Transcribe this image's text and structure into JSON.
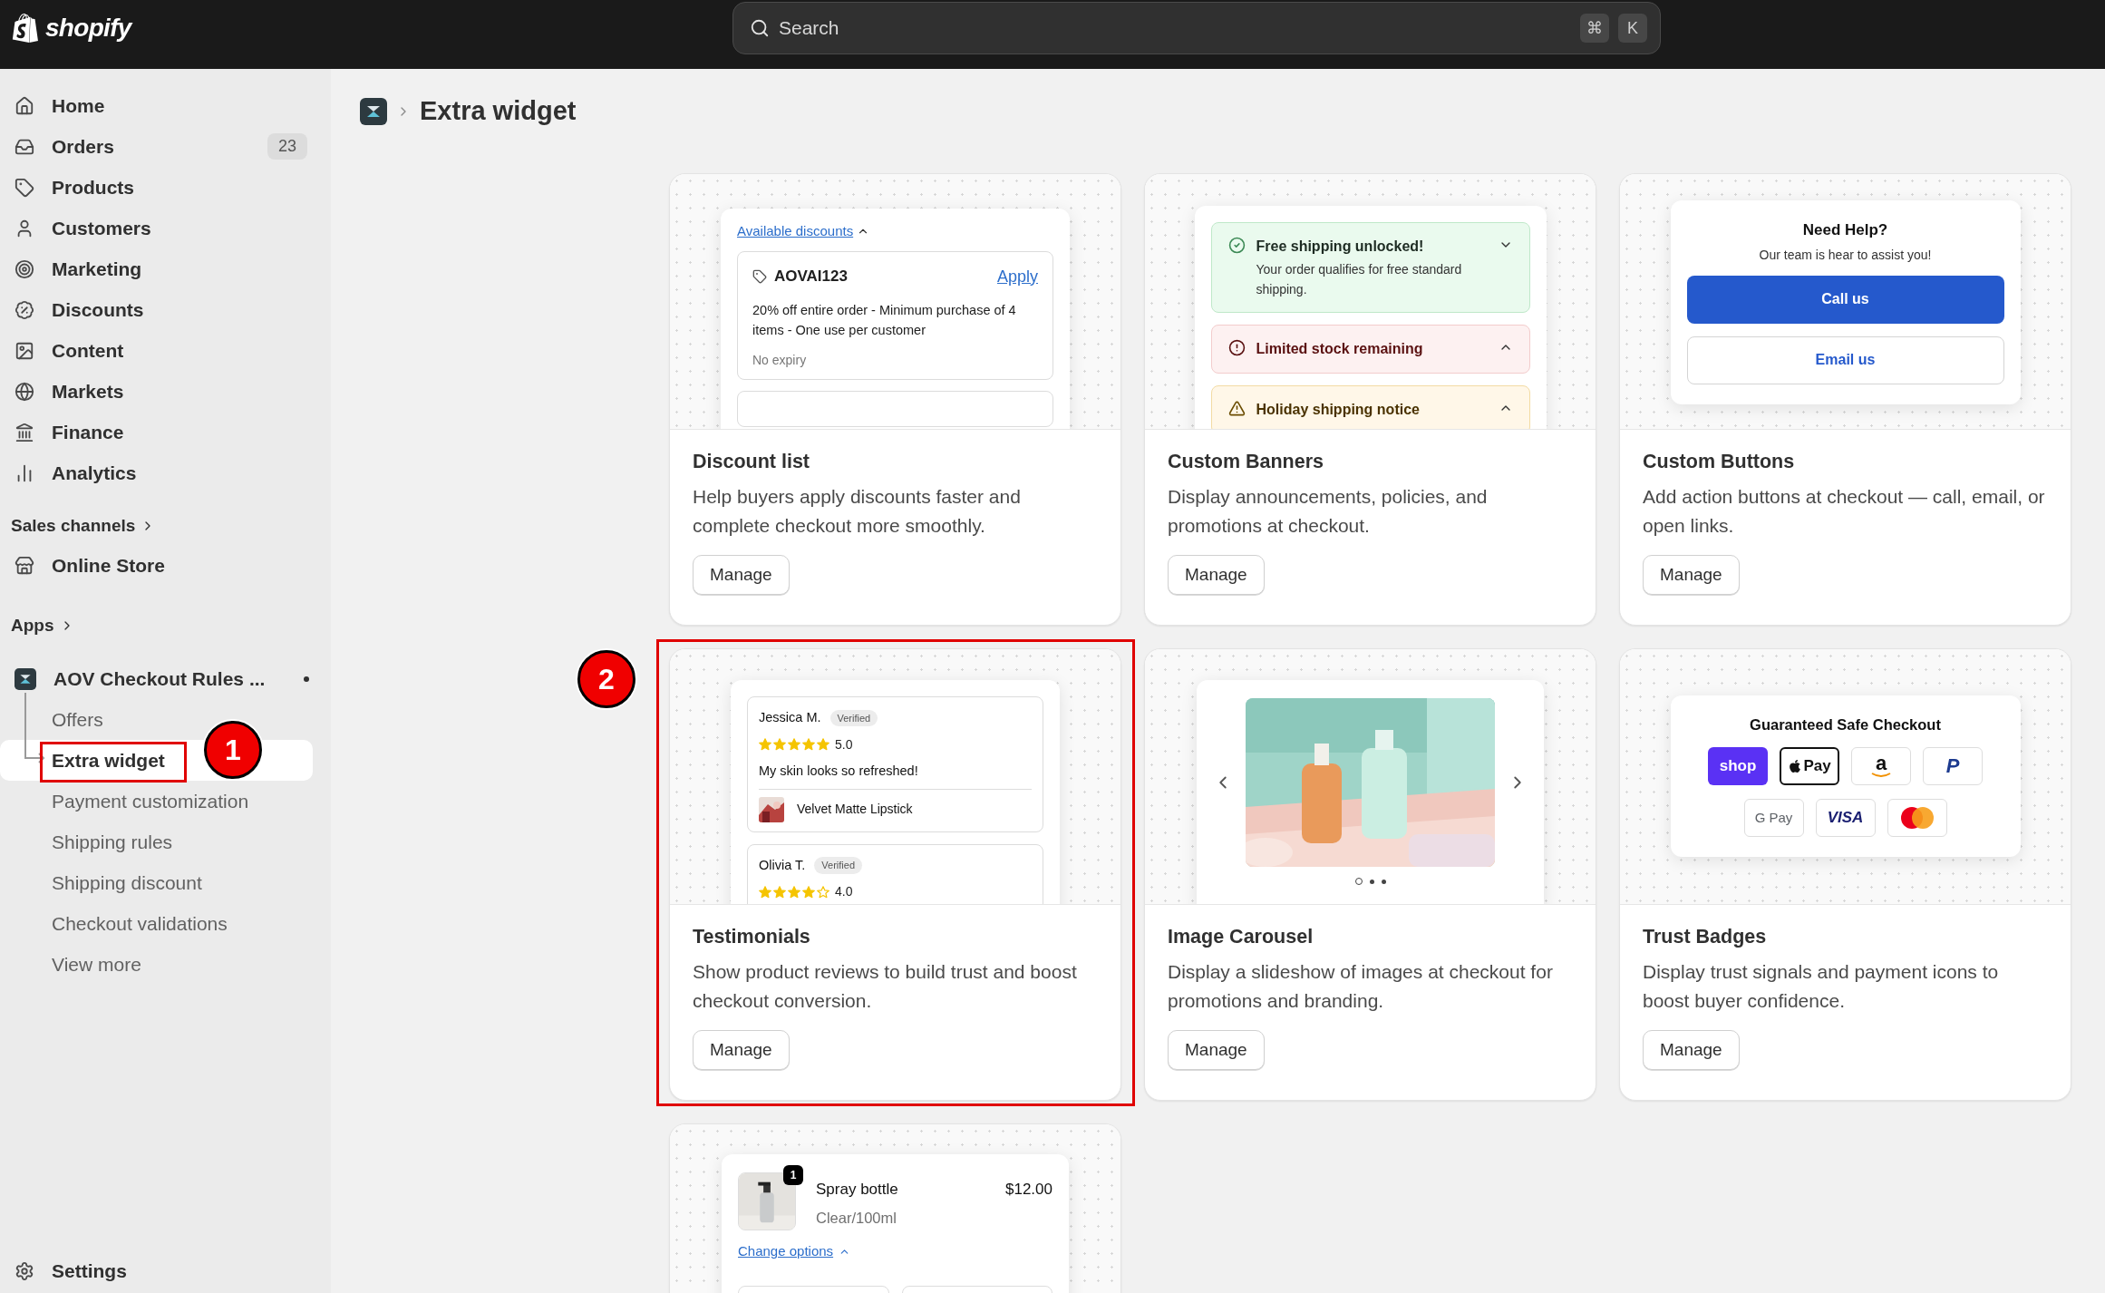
{
  "topbar": {
    "logo": "shopify",
    "search": {
      "placeholder": "Search",
      "keys": [
        "⌘",
        "K"
      ]
    }
  },
  "sidebar": {
    "nav": [
      {
        "label": "Home"
      },
      {
        "label": "Orders",
        "count": "23"
      },
      {
        "label": "Products"
      },
      {
        "label": "Customers"
      },
      {
        "label": "Marketing"
      },
      {
        "label": "Discounts"
      },
      {
        "label": "Content"
      },
      {
        "label": "Markets"
      },
      {
        "label": "Finance"
      },
      {
        "label": "Analytics"
      }
    ],
    "sales_channels": {
      "heading": "Sales channels",
      "items": [
        {
          "label": "Online Store"
        }
      ]
    },
    "apps": {
      "heading": "Apps",
      "app": {
        "label": "AOV Checkout Rules ...",
        "children": [
          {
            "label": "Offers",
            "selected": false
          },
          {
            "label": "Extra widget",
            "selected": true
          },
          {
            "label": "Payment customization",
            "selected": false
          },
          {
            "label": "Shipping rules",
            "selected": false
          },
          {
            "label": "Shipping discount",
            "selected": false
          },
          {
            "label": "Checkout validations",
            "selected": false
          },
          {
            "label": "View more",
            "selected": false
          }
        ]
      }
    },
    "settings": {
      "label": "Settings"
    }
  },
  "breadcrumb": {
    "title": "Extra widget"
  },
  "cards": [
    {
      "title": "Discount list",
      "description": "Help buyers apply discounts faster and complete checkout more smoothly.",
      "button": "Manage",
      "preview": {
        "kind": "discounts",
        "link": "Available discounts",
        "code": "AOVAI123",
        "action": "Apply",
        "details": "20% off entire order - Minimum purchase of 4 items - One use per customer",
        "expiry": "No expiry"
      }
    },
    {
      "title": "Custom Banners",
      "description": "Display announcements, policies, and promotions at checkout.",
      "button": "Manage",
      "preview": {
        "kind": "banners",
        "banners": [
          {
            "kind": "success",
            "title": "Free shipping unlocked!",
            "body": "Your order qualifies for free standard shipping.",
            "expanded": true
          },
          {
            "kind": "critical",
            "title": "Limited stock remaining",
            "expanded": false
          },
          {
            "kind": "warning",
            "title": "Holiday shipping notice",
            "expanded": false
          }
        ]
      }
    },
    {
      "title": "Custom Buttons",
      "description": "Add action buttons at checkout — call, email, or open links.",
      "button": "Manage",
      "preview": {
        "kind": "buttons",
        "heading": "Need Help?",
        "subheading": "Our team is hear to assist you!",
        "actions": [
          {
            "label": "Call us",
            "kind": "primary"
          },
          {
            "label": "Email us",
            "kind": "secondary"
          }
        ]
      }
    },
    {
      "title": "Testimonials",
      "description": "Show product reviews to build trust and boost checkout conversion.",
      "button": "Manage",
      "preview": {
        "kind": "testimonials",
        "reviews": [
          {
            "name": "Jessica M.",
            "badge": "Verified",
            "stars": 5,
            "rating": "5.0",
            "text": "My skin looks so refreshed!",
            "product": "Velvet Matte Lipstick"
          },
          {
            "name": "Olivia T.",
            "badge": "Verified",
            "stars": 4,
            "rating": "4.0"
          }
        ]
      }
    },
    {
      "title": "Image Carousel",
      "description": "Display a slideshow of images at checkout for promotions and branding.",
      "button": "Manage",
      "preview": {
        "kind": "carousel",
        "dots": [
          {
            "selected": true
          },
          {
            "selected": false
          },
          {
            "selected": false
          }
        ]
      }
    },
    {
      "title": "Trust Badges",
      "description": "Display trust signals and payment icons to boost buyer confidence.",
      "button": "Manage",
      "preview": {
        "kind": "trust_badges",
        "heading": "Guaranteed Safe Checkout",
        "badges": [
          {
            "kind": "shop",
            "text": "shop"
          },
          {
            "kind": "apple_pay",
            "text": "Pay"
          },
          {
            "kind": "amazon",
            "text": "a"
          },
          {
            "kind": "paypal",
            "text": "P"
          },
          {
            "kind": "google_pay",
            "text": "G Pay"
          },
          {
            "kind": "visa",
            "text": "VISA"
          },
          {
            "kind": "mastercard"
          }
        ]
      }
    },
    {
      "preview": {
        "kind": "cart_item",
        "quantity": "1",
        "name": "Spray bottle",
        "price": "$12.00",
        "variant": "Clear/100ml",
        "link": "Change options"
      }
    }
  ],
  "annotations": [
    {
      "label": "1"
    },
    {
      "label": "2"
    }
  ]
}
